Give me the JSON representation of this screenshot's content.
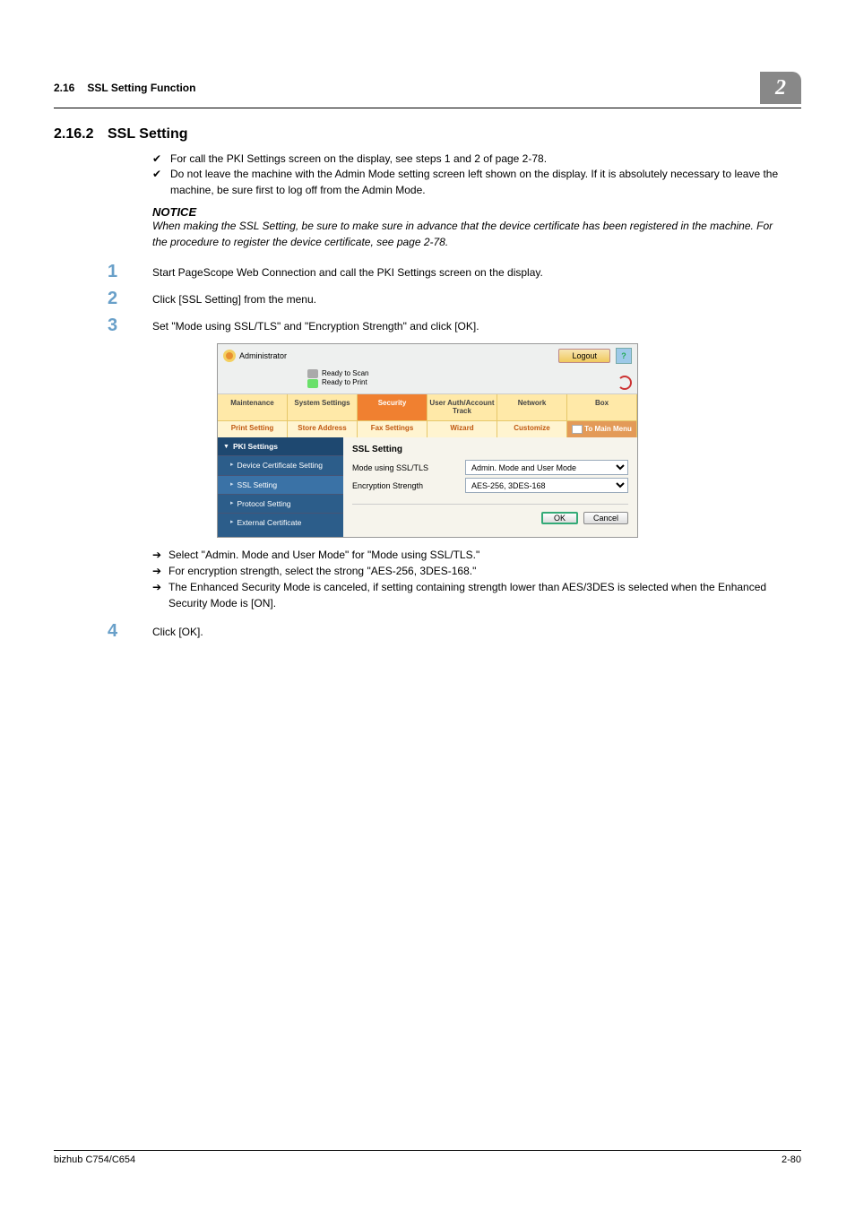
{
  "header": {
    "section": "2.16",
    "title": "SSL Setting Function",
    "chapter": "2"
  },
  "heading": {
    "number": "2.16.2",
    "title": "SSL Setting"
  },
  "checks": {
    "c1": "For call the PKI Settings screen on the display, see steps 1 and 2 of page 2-78.",
    "c2": "Do not leave the machine with the Admin Mode setting screen left shown on the display. If it is absolutely necessary to leave the machine, be sure first to log off from the Admin Mode."
  },
  "notice": {
    "label": "NOTICE",
    "text": "When making the SSL Setting, be sure to make sure in advance that the device certificate has been registered in the machine. For the procedure to register the device certificate, see page 2-78."
  },
  "steps": {
    "s1": "Start PageScope Web Connection and call the PKI Settings screen on the display.",
    "s2": "Click [SSL Setting] from the menu.",
    "s3": "Set \"Mode using SSL/TLS\" and \"Encryption Strength\" and click [OK].",
    "s4": "Click [OK]."
  },
  "arrows": {
    "a1": "Select \"Admin. Mode and User Mode\" for \"Mode using SSL/TLS.\"",
    "a2": "For encryption strength, select the strong \"AES-256, 3DES-168.\"",
    "a3": "The Enhanced Security Mode is canceled, if setting containing strength lower than AES/3DES is selected when the Enhanced Security Mode is [ON]."
  },
  "shot": {
    "admin_label": "Administrator",
    "logout": "Logout",
    "help": "?",
    "status_scan": "Ready to Scan",
    "status_print": "Ready to Print",
    "tabs_main": {
      "t1": "Maintenance",
      "t2": "System Settings",
      "t3": "Security",
      "t4": "User Auth/Account Track",
      "t5": "Network",
      "t6": "Box"
    },
    "tabs_sub": {
      "t1": "Print Setting",
      "t2": "Store Address",
      "t3": "Fax Settings",
      "t4": "Wizard",
      "t5": "Customize",
      "t6": "To Main Menu"
    },
    "side": {
      "head": "PKI Settings",
      "i1": "Device Certificate Setting",
      "i2": "SSL Setting",
      "i3": "Protocol Setting",
      "i4": "External Certificate"
    },
    "panel": {
      "title": "SSL Setting",
      "row1_label": "Mode using SSL/TLS",
      "row1_value": "Admin. Mode and User Mode",
      "row2_label": "Encryption Strength",
      "row2_value": "AES-256, 3DES-168",
      "ok": "OK",
      "cancel": "Cancel"
    }
  },
  "footer": {
    "left": "bizhub C754/C654",
    "right": "2-80"
  }
}
